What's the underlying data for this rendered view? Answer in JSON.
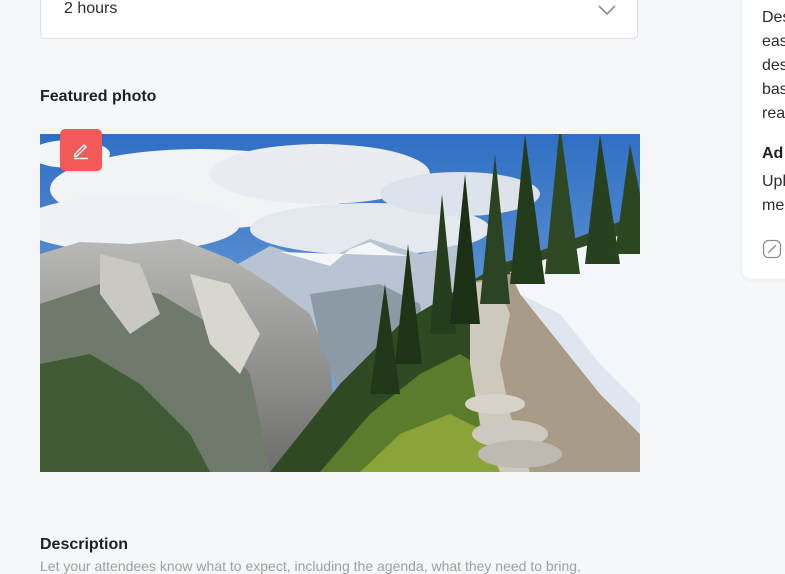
{
  "duration_select": {
    "value": "2 hours",
    "icon": "chevron-down-icon"
  },
  "featured_photo": {
    "title": "Featured photo",
    "edit_icon": "pencil-icon",
    "edit_color": "#f25a5a"
  },
  "description": {
    "title": "Description",
    "help_text": "Let your attendees know what to expect, including the agenda, what they need to bring,"
  },
  "side_card": {
    "lines": [
      "Des",
      "eas",
      "des",
      "bas",
      "rea"
    ],
    "heading": "Ad",
    "lines2": [
      "Upl",
      "me"
    ],
    "icon": "external-link-icon"
  }
}
